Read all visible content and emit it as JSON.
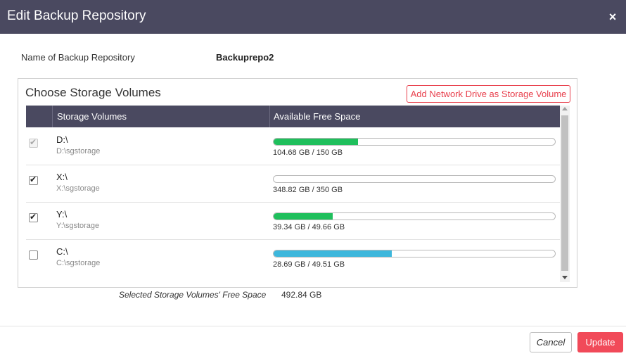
{
  "dialog": {
    "title": "Edit Backup Repository",
    "close_icon": "×"
  },
  "repo": {
    "name_label": "Name of Backup Repository",
    "name_value": "Backuprepo2"
  },
  "volumes": {
    "title": "Choose Storage Volumes",
    "add_button": "Add Network Drive as Storage Volume",
    "columns": [
      "Storage Volumes",
      "Available Free Space"
    ],
    "rows": [
      {
        "drive": "D:\\",
        "path": "D:\\sgstorage",
        "space": "104.68 GB / 150 GB",
        "checked": true,
        "disabled": true,
        "fill_ratio": 0.3,
        "bar_color": "#1fbf5c"
      },
      {
        "drive": "X:\\",
        "path": "X:\\sgstorage",
        "space": "348.82 GB / 350 GB",
        "checked": true,
        "disabled": false,
        "fill_ratio": 0.0,
        "bar_color": "#1fbf5c"
      },
      {
        "drive": "Y:\\",
        "path": "Y:\\sgstorage",
        "space": "39.34 GB / 49.66 GB",
        "checked": true,
        "disabled": false,
        "fill_ratio": 0.21,
        "bar_color": "#1fbf5c"
      },
      {
        "drive": "C:\\",
        "path": "C:\\sgstorage",
        "space": "28.69 GB / 49.51 GB",
        "checked": false,
        "disabled": false,
        "fill_ratio": 0.42,
        "bar_color": "#3db7dc"
      }
    ]
  },
  "summary": {
    "label": "Selected Storage Volumes' Free Space",
    "value": "492.84 GB"
  },
  "footer": {
    "cancel_label": "Cancel",
    "update_label": "Update"
  },
  "colors": {
    "header_bg": "#4a4960",
    "accent_red": "#f14a59",
    "bar_green": "#1fbf5c",
    "bar_blue": "#3db7dc"
  }
}
